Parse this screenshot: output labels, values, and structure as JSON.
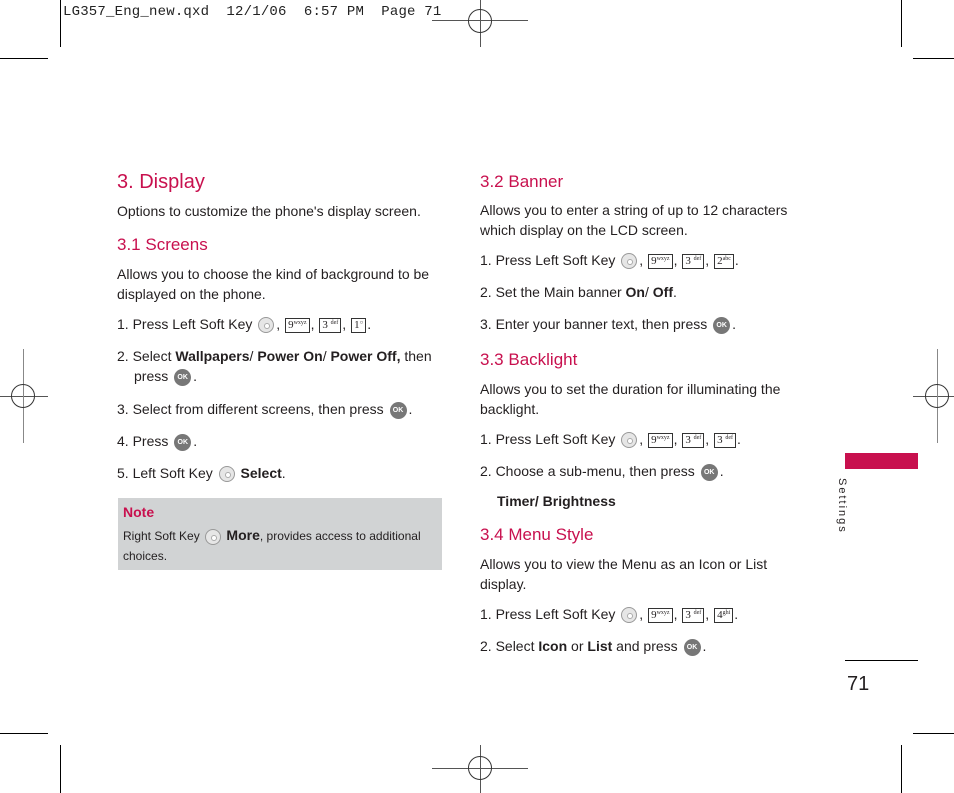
{
  "slug": "LG357_Eng_new.qxd  12/1/06  6:57 PM  Page 71",
  "left": {
    "title": "3. Display",
    "intro": "Options to customize the phone's display screen.",
    "screens": {
      "heading": "3.1 Screens",
      "desc1": "Allows you to choose the kind of background to be",
      "desc2": "displayed on the phone.",
      "step1_prefix": "1. Press Left Soft Key",
      "step1_keys": [
        "9wxyz",
        "3def",
        "1"
      ],
      "step2_prefix": "2. Select ",
      "step2_bold1": "Wallpapers",
      "step2_bold2": "Power On",
      "step2_bold3": "Power Off,",
      "step2_suffix": " then",
      "step2_line2": "press",
      "step3": "3. Select from different screens, then press",
      "step4": "4. Press",
      "step5_prefix": "5. Left Soft Key",
      "step5_bold": "Select"
    },
    "note": {
      "title": "Note",
      "prefix": "Right Soft Key",
      "bold": "More",
      "suffix": ", provides access to additional",
      "line2": "choices."
    }
  },
  "right": {
    "banner": {
      "heading": "3.2 Banner",
      "desc1": "Allows you to enter a string of up to 12 characters",
      "desc2": "which display on the LCD screen.",
      "step1_prefix": "1. Press Left Soft Key",
      "step1_keys": [
        "9wxyz",
        "3def",
        "2abc"
      ],
      "step2_prefix": "2. Set the Main banner ",
      "step2_bold1": "On",
      "step2_bold2": "Off",
      "step3": "3. Enter your banner text, then press"
    },
    "backlight": {
      "heading": "3.3 Backlight",
      "desc1": "Allows you to set the duration for illuminating the",
      "desc2": "backlight.",
      "step1_prefix": "1. Press Left Soft Key",
      "step1_keys": [
        "9wxyz",
        "3def",
        "3def"
      ],
      "step2": "2. Choose a sub-menu, then press",
      "options": "Timer/ Brightness"
    },
    "menustyle": {
      "heading": "3.4 Menu Style",
      "desc1": "Allows you to view the Menu as an Icon or List",
      "desc2": "display.",
      "step1_prefix": "1. Press Left Soft Key",
      "step1_keys": [
        "9wxyz",
        "3def",
        "4ghi"
      ],
      "step2_prefix": "2. Select ",
      "step2_bold1": "Icon",
      "step2_mid": " or ",
      "step2_bold2": "List",
      "step2_suffix": " and press"
    }
  },
  "side_tab": "Settings",
  "page_number": "71",
  "ok_label": "OK",
  "colors": {
    "accent": "#c8104e",
    "note_bg": "#d1d3d4"
  }
}
